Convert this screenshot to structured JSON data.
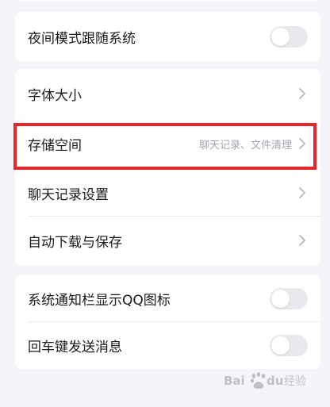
{
  "settings": {
    "night_mode": {
      "label": "夜间模式跟随系统",
      "enabled": false
    },
    "font_size": {
      "label": "字体大小"
    },
    "storage": {
      "label": "存储空间",
      "subtitle": "聊天记录、文件清理"
    },
    "chat_history": {
      "label": "聊天记录设置"
    },
    "auto_download": {
      "label": "自动下载与保存"
    },
    "notification_qq_icon": {
      "label": "系统通知栏显示QQ图标",
      "enabled": false
    },
    "enter_to_send": {
      "label": "回车键发送消息",
      "enabled": false
    }
  },
  "colors": {
    "highlight_border": "#e8262a",
    "toggle_off": "#e8e9ed",
    "background": "#f4f5f9"
  },
  "watermark": {
    "logo": "Bai du 经验"
  }
}
